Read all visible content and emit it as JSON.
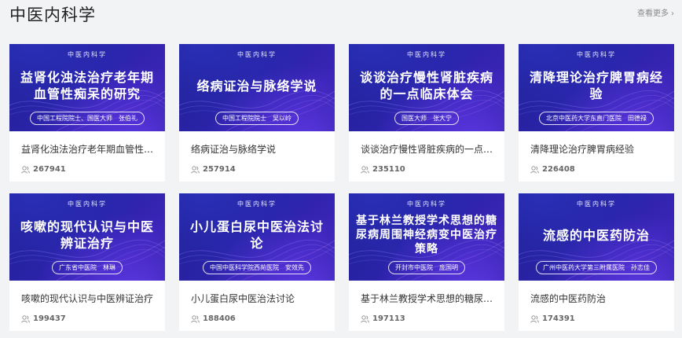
{
  "section": {
    "title": "中医内科学",
    "more_label": "查看更多",
    "more_icon": "chevron-right-icon"
  },
  "colors": {
    "cover_dark": "#1d1f8e",
    "cover_accent": "#5a36e0",
    "page_bg": "#f2f3f5"
  },
  "courses": [
    {
      "cover_label": "中医内科学",
      "cover_title": "益肾化浊法治疗老年期血管性痴呆的研究",
      "cover_author": "中国工程院院士、国医大师　张伯礼",
      "title": "益肾化浊法治疗老年期血管性…",
      "views": "267941"
    },
    {
      "cover_label": "中医内科学",
      "cover_title": "络病证治与脉络学说",
      "cover_author": "中国工程院院士　吴以岭",
      "title": "络病证治与脉络学说",
      "views": "257914"
    },
    {
      "cover_label": "中医内科学",
      "cover_title": "谈谈治疗慢性肾脏疾病的一点临床体会",
      "cover_author": "国医大师　张大宁",
      "title": "谈谈治疗慢性肾脏疾病的一点…",
      "views": "235110"
    },
    {
      "cover_label": "中医内科学",
      "cover_title": "清降理论治疗脾胃病经验",
      "cover_author": "北京中医药大学东直门医院　田德禄",
      "title": "清降理论治疗脾胃病经验",
      "views": "226408"
    },
    {
      "cover_label": "中医内科学",
      "cover_title": "咳嗽的现代认识与中医辨证治疗",
      "cover_author": "广东省中医院　林琳",
      "title": "咳嗽的现代认识与中医辨证治疗",
      "views": "199437"
    },
    {
      "cover_label": "中医内科学",
      "cover_title": "小儿蛋白尿中医治法讨论",
      "cover_author": "中国中医科学院西苑医院　安效先",
      "title": "小儿蛋白尿中医治法讨论",
      "views": "188406"
    },
    {
      "cover_label": "中医内科学",
      "cover_title": "基于林兰教授学术思想的糖尿病周围神经病变中医治疗策略",
      "cover_author": "开封市中医院　庞国明",
      "title": "基于林兰教授学术思想的糖尿…",
      "views": "197113"
    },
    {
      "cover_label": "中医内科学",
      "cover_title": "流感的中医药防治",
      "cover_author": "广州中医药大学第三附属医院　孙志佳",
      "title": "流感的中医药防治",
      "views": "174391"
    }
  ]
}
